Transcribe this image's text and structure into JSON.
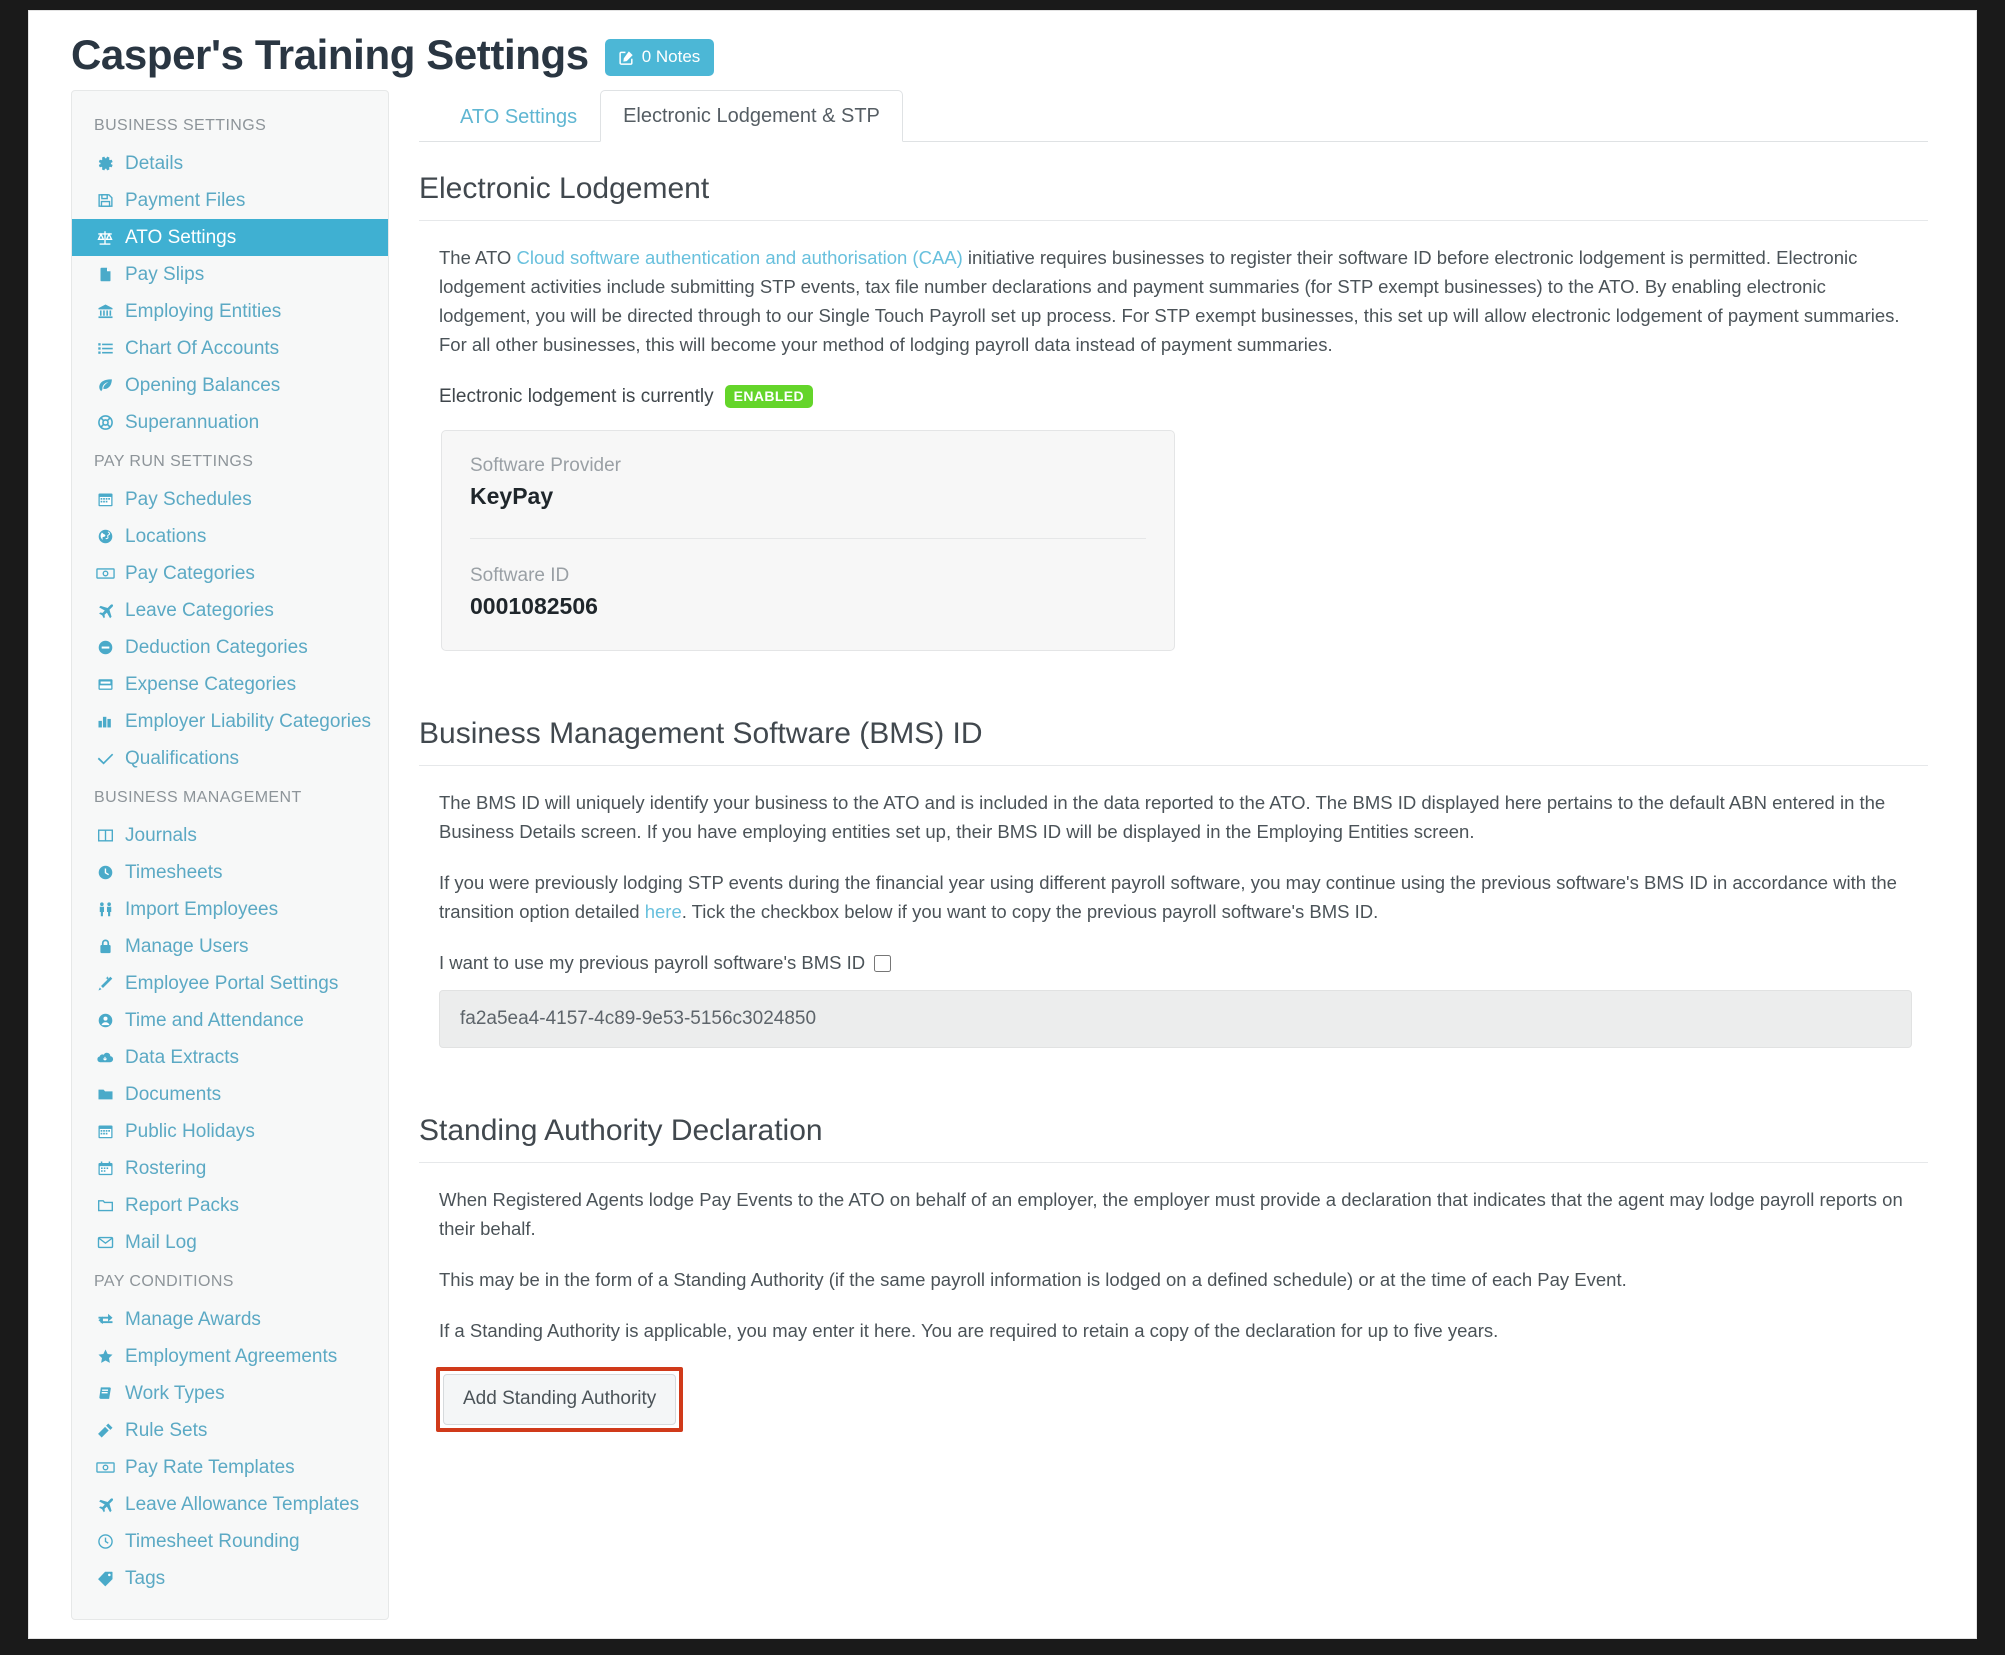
{
  "header": {
    "title": "Casper's Training Settings",
    "notes_badge": "0 Notes",
    "notes_icon": "edit-square-icon"
  },
  "sidebar": {
    "groups": [
      {
        "title": "BUSINESS SETTINGS",
        "items": [
          {
            "label": "Details",
            "icon": "gear-icon",
            "active": false
          },
          {
            "label": "Payment Files",
            "icon": "floppy-disk-icon",
            "active": false
          },
          {
            "label": "ATO Settings",
            "icon": "scales-icon",
            "active": true
          },
          {
            "label": "Pay Slips",
            "icon": "file-icon",
            "active": false
          },
          {
            "label": "Employing Entities",
            "icon": "bank-icon",
            "active": false
          },
          {
            "label": "Chart Of Accounts",
            "icon": "list-icon",
            "active": false
          },
          {
            "label": "Opening Balances",
            "icon": "leaf-icon",
            "active": false
          },
          {
            "label": "Superannuation",
            "icon": "lifebuoy-icon",
            "active": false
          }
        ]
      },
      {
        "title": "PAY RUN SETTINGS",
        "items": [
          {
            "label": "Pay Schedules",
            "icon": "calendar-icon",
            "active": false
          },
          {
            "label": "Locations",
            "icon": "globe-icon",
            "active": false
          },
          {
            "label": "Pay Categories",
            "icon": "money-icon",
            "active": false
          },
          {
            "label": "Leave Categories",
            "icon": "plane-icon",
            "active": false
          },
          {
            "label": "Deduction Categories",
            "icon": "minus-circle-icon",
            "active": false
          },
          {
            "label": "Expense Categories",
            "icon": "inbox-icon",
            "active": false
          },
          {
            "label": "Employer Liability Categories",
            "icon": "bar-chart-icon",
            "active": false
          },
          {
            "label": "Qualifications",
            "icon": "check-icon",
            "active": false
          }
        ]
      },
      {
        "title": "BUSINESS MANAGEMENT",
        "items": [
          {
            "label": "Journals",
            "icon": "columns-icon",
            "active": false
          },
          {
            "label": "Timesheets",
            "icon": "clock-icon",
            "active": false
          },
          {
            "label": "Import Employees",
            "icon": "people-icon",
            "active": false
          },
          {
            "label": "Manage Users",
            "icon": "lock-icon",
            "active": false
          },
          {
            "label": "Employee Portal Settings",
            "icon": "magic-wand-icon",
            "active": false
          },
          {
            "label": "Time and Attendance",
            "icon": "user-circle-icon",
            "active": false
          },
          {
            "label": "Data Extracts",
            "icon": "cloud-download-icon",
            "active": false
          },
          {
            "label": "Documents",
            "icon": "folder-icon",
            "active": false
          },
          {
            "label": "Public Holidays",
            "icon": "calendar-icon",
            "active": false
          },
          {
            "label": "Rostering",
            "icon": "calendar-alt-icon",
            "active": false
          },
          {
            "label": "Report Packs",
            "icon": "folder-open-icon",
            "active": false
          },
          {
            "label": "Mail Log",
            "icon": "envelope-icon",
            "active": false
          }
        ]
      },
      {
        "title": "PAY CONDITIONS",
        "items": [
          {
            "label": "Manage Awards",
            "icon": "exchange-icon",
            "active": false
          },
          {
            "label": "Employment Agreements",
            "icon": "star-icon",
            "active": false
          },
          {
            "label": "Work Types",
            "icon": "book-icon",
            "active": false
          },
          {
            "label": "Rule Sets",
            "icon": "gavel-icon",
            "active": false
          },
          {
            "label": "Pay Rate Templates",
            "icon": "money-icon",
            "active": false
          },
          {
            "label": "Leave Allowance Templates",
            "icon": "plane-icon",
            "active": false
          },
          {
            "label": "Timesheet Rounding",
            "icon": "clock-outline-icon",
            "active": false
          },
          {
            "label": "Tags",
            "icon": "tag-icon",
            "active": false
          }
        ]
      }
    ]
  },
  "tabs": [
    {
      "label": "ATO Settings",
      "active": false
    },
    {
      "label": "Electronic Lodgement & STP",
      "active": true
    }
  ],
  "electronic_lodgement": {
    "heading": "Electronic Lodgement",
    "intro_prefix": "The ATO ",
    "intro_link": "Cloud software authentication and authorisation (CAA)",
    "intro_rest": " initiative requires businesses to register their software ID before electronic lodgement is permitted. Electronic lodgement activities include submitting STP events, tax file number declarations and payment summaries (for STP exempt businesses) to the ATO. By enabling electronic lodgement, you will be directed through to our Single Touch Payroll set up process. For STP exempt businesses, this set up will allow electronic lodgement of payment summaries. For all other businesses, this will become your method of lodging payroll data instead of payment summaries.",
    "status_label": "Electronic lodgement is currently",
    "status_value": "ENABLED",
    "provider_label": "Software Provider",
    "provider_value": "KeyPay",
    "software_id_label": "Software ID",
    "software_id_value": "0001082506"
  },
  "bms": {
    "heading": "Business Management Software (BMS) ID",
    "paragraph1": "The BMS ID will uniquely identify your business to the ATO and is included in the data reported to the ATO. The BMS ID displayed here pertains to the default ABN entered in the Business Details screen. If you have employing entities set up, their BMS ID will be displayed in the Employing Entities screen.",
    "paragraph2_prefix": "If you were previously lodging STP events during the financial year using different payroll software, you may continue using the previous software's BMS ID in accordance with the transition option detailed ",
    "paragraph2_link": "here",
    "paragraph2_rest": ". Tick the checkbox below if you want to copy the previous payroll software's BMS ID.",
    "checkbox_label": "I want to use my previous payroll software's BMS ID",
    "checkbox_checked": false,
    "bms_id_value": "fa2a5ea4-4157-4c89-9e53-5156c3024850"
  },
  "standing_authority": {
    "heading": "Standing Authority Declaration",
    "paragraph1": "When Registered Agents lodge Pay Events to the ATO on behalf of an employer, the employer must provide a declaration that indicates that the agent may lodge payroll reports on their behalf.",
    "paragraph2": "This may be in the form of a Standing Authority (if the same payroll information is lodged on a defined schedule) or at the time of each Pay Event.",
    "paragraph3": "If a Standing Authority is applicable, you may enter it here. You are required to retain a copy of the declaration for up to five years.",
    "add_button": "Add Standing Authority"
  },
  "colors": {
    "accent": "#3fb0d2",
    "link": "#68c0dd",
    "enabled_badge": "#64d52a",
    "annotation": "#d03a1a",
    "sidebar_bg": "#f7f8f8"
  }
}
